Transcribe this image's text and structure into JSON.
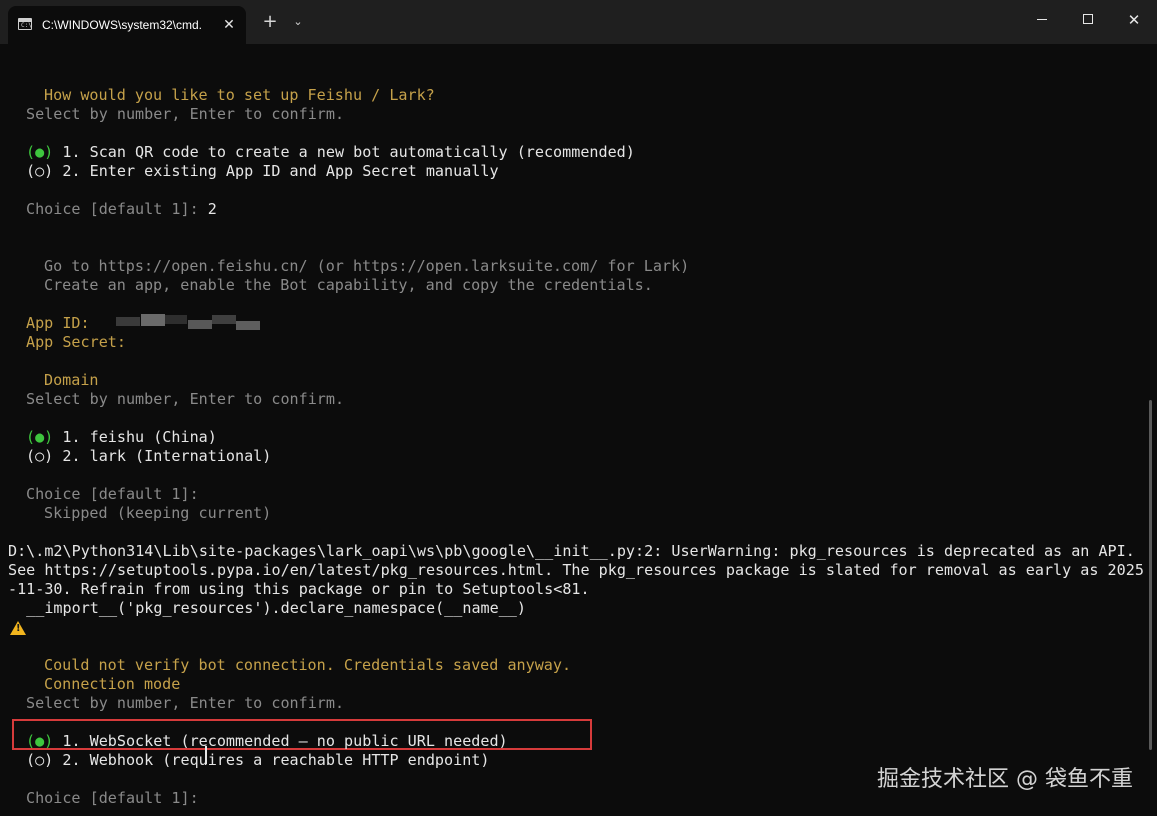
{
  "titlebar": {
    "tab_title": "C:\\WINDOWS\\system32\\cmd.",
    "tab_close": "✕",
    "new_tab": "+",
    "tab_dropdown": "⌄",
    "close_glyph": "✕",
    "tab_icon_text": "C:\\"
  },
  "terminal": {
    "setup_question": "How would you like to set up Feishu / Lark?",
    "select_hint_1": "Select by number, Enter to confirm.",
    "opt1_marker": "(●)",
    "opt1_text": " 1. Scan QR code to create a new bot automatically (recommended)",
    "opt2_marker": "(○)",
    "opt2_text": " 2. Enter existing App ID and App Secret manually",
    "choice_prompt_1": "Choice [default 1]:",
    "choice_value_1": " 2",
    "goto_line": "Go to https://open.feishu.cn/ (or https://open.larksuite.com/ for Lark)",
    "create_line": "Create an app, enable the Bot capability, and copy the credentials.",
    "app_id_label": "App ID:",
    "app_secret_label": "App Secret:",
    "domain_title": "Domain",
    "select_hint_2": "Select by number, Enter to confirm.",
    "dom1_marker": "(●)",
    "dom1_text": " 1. feishu (China)",
    "dom2_marker": "(○)",
    "dom2_text": " 2. lark (International)",
    "choice_prompt_2": "Choice [default 1]:",
    "skipped_line": "Skipped (keeping current)",
    "warning_line_1": "D:\\.m2\\Python314\\Lib\\site-packages\\lark_oapi\\ws\\pb\\google\\__init__.py:2: UserWarning: pkg_resources is deprecated as an API.",
    "warning_line_2": "See https://setuptools.pypa.io/en/latest/pkg_resources.html. The pkg_resources package is slated for removal as early as 2025",
    "warning_line_3": "-11-30. Refrain from using this package or pin to Setuptools<81.",
    "warning_line_4": "  __import__('pkg_resources').declare_namespace(__name__)",
    "verify_warning": "Could not verify bot connection. Credentials saved anyway.",
    "warning_icon_glyph": "!",
    "conn_title": "Connection mode",
    "select_hint_3": "Select by number, Enter to confirm.",
    "conn1_marker": "(●)",
    "conn1_text": " 1. WebSocket (recommended — no public URL needed)",
    "conn2_marker": "(○)",
    "conn2_text": " 2. Webhook (requires a reachable HTTP endpoint)",
    "choice_prompt_3": "Choice [default 1]:"
  },
  "watermark": "掘金技术社区 @ 袋鱼不重",
  "colors": {
    "background": "#0c0c0c",
    "yellow": "#c5a14a",
    "green": "#3ec63e",
    "highlight": "#d63b3b"
  }
}
